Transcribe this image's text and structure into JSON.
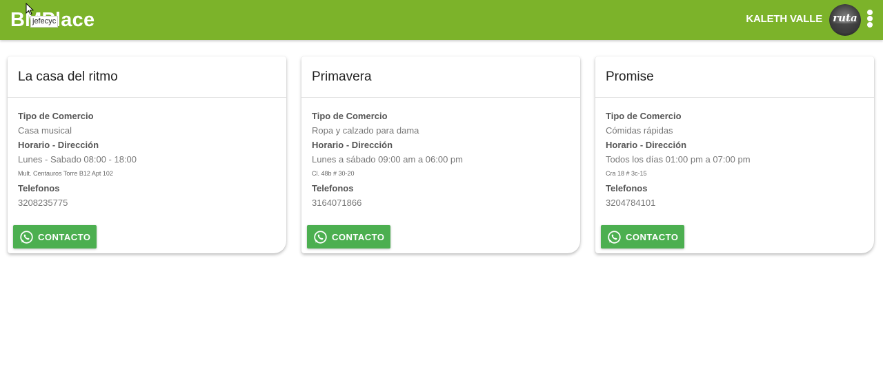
{
  "app": {
    "brand": "BMPlace",
    "tooltip": "jefecyc",
    "user_name": "KALETH VALLE",
    "avatar_text": "ruta"
  },
  "labels": {
    "type": "Tipo de Comercio",
    "schedule": "Horario - Dirección",
    "phones": "Telefonos",
    "contact": "CONTACTO"
  },
  "stores": [
    {
      "name": "La casa del ritmo",
      "type": "Casa musical",
      "schedule": "Lunes - Sabado 08:00 - 18:00",
      "address": "Mult. Centauros Torre B12 Apt 102",
      "phone": "3208235775"
    },
    {
      "name": "Primavera",
      "type": "Ropa y calzado para dama",
      "schedule": "Lunes a sábado 09:00 am a 06:00 pm",
      "address": "Cl. 48b # 30-20",
      "phone": "3164071866"
    },
    {
      "name": "Promise",
      "type": "Cómidas rápidas",
      "schedule": "Todos los días 01:00 pm a 07:00 pm",
      "address": "Cra 18 # 3c-15",
      "phone": "3204784101"
    }
  ],
  "colors": {
    "topbar": "#7cb32a",
    "contact_button": "#4caf50"
  },
  "icons": {
    "contact": "whatsapp-icon",
    "menu": "more-vert-icon",
    "cursor": "mouse-pointer-icon"
  }
}
